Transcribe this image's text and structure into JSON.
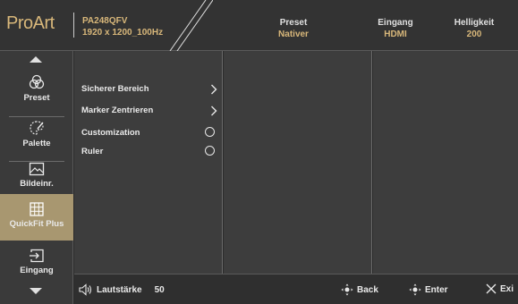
{
  "header": {
    "logo": "ProArt",
    "model_name": "PA248QFV",
    "resolution": "1920 x 1200_100Hz",
    "stats": [
      {
        "label": "Preset",
        "value": "Nativer"
      },
      {
        "label": "Eingang",
        "value": "HDMI"
      },
      {
        "label": "Helligkeit",
        "value": "200"
      }
    ]
  },
  "sidebar": {
    "items": [
      {
        "label": "Preset",
        "icon": "palette-swatches-icon"
      },
      {
        "label": "Palette",
        "icon": "paint-palette-icon"
      },
      {
        "label": "Bildeinr.",
        "icon": "image-icon"
      },
      {
        "label": "QuickFit Plus",
        "icon": "grid-icon",
        "active": true
      },
      {
        "label": "Eingang",
        "icon": "input-arrow-icon"
      }
    ]
  },
  "menu": {
    "items": [
      {
        "label": "Sicherer Bereich",
        "control": "chevron"
      },
      {
        "label": "Marker Zentrieren",
        "control": "chevron"
      },
      {
        "label": "Customization",
        "control": "radio"
      },
      {
        "label": "Ruler",
        "control": "radio"
      }
    ]
  },
  "footer": {
    "volume_label": "Lautstärke",
    "volume_value": "50",
    "back_label": "Back",
    "enter_label": "Enter",
    "exit_label": "Exi"
  },
  "colors": {
    "accent": "#d8b77a",
    "active_item": "#a89770",
    "panel": "#3d3d3d"
  }
}
